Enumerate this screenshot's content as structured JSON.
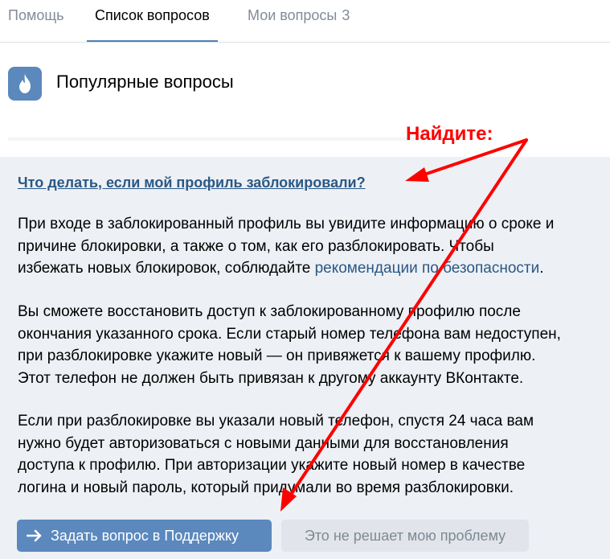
{
  "tabs": [
    {
      "label": "Помощь"
    },
    {
      "label": "Список вопросов"
    },
    {
      "label": "Мои вопросы",
      "count": "3"
    }
  ],
  "header": {
    "icon": "fire-icon",
    "title": "Популярные вопросы"
  },
  "answer": {
    "question": "Что делать, если мой профиль заблокировали?",
    "paragraph1": {
      "lines": [
        "При входе в заблокированный профиль вы увидите информацию о сроке и",
        "причине блокировки, а также о том, как его разблокировать. Чтобы"
      ],
      "line3_prefix": "избежать новых блокировок, соблюдайте ",
      "link": "рекомендации по безопасности",
      "line3_suffix": "."
    },
    "paragraph2": [
      "Вы сможете восстановить доступ к заблокированному профилю после",
      "окончания указанного срока. Если старый номер телефона вам недоступен,",
      "при разблокировке укажите новый — он привяжется к вашему профилю.",
      "Этот телефон не должен быть привязан к другому аккаунту ВКонтакте."
    ],
    "paragraph3": [
      "Если при разблокировке вы указали новый телефон, спустя 24 часа вам",
      "нужно будет авторизоваться с новыми данными для восстановления",
      "доступа к профилю. При авторизации укажите новый номер в качестве",
      "логина и новый пароль, который придумали во время разблокировки."
    ]
  },
  "buttons": {
    "ask_support": "Задать вопрос в Поддержку",
    "not_solved": "Это не решает мою проблему"
  },
  "annotation": {
    "label": "Найдите:",
    "color": "#ff0000"
  },
  "colors": {
    "accent": "#5181b8",
    "link": "#2a5885",
    "panel_bg": "#edf0f5",
    "primary_button": "#5b88bd"
  }
}
